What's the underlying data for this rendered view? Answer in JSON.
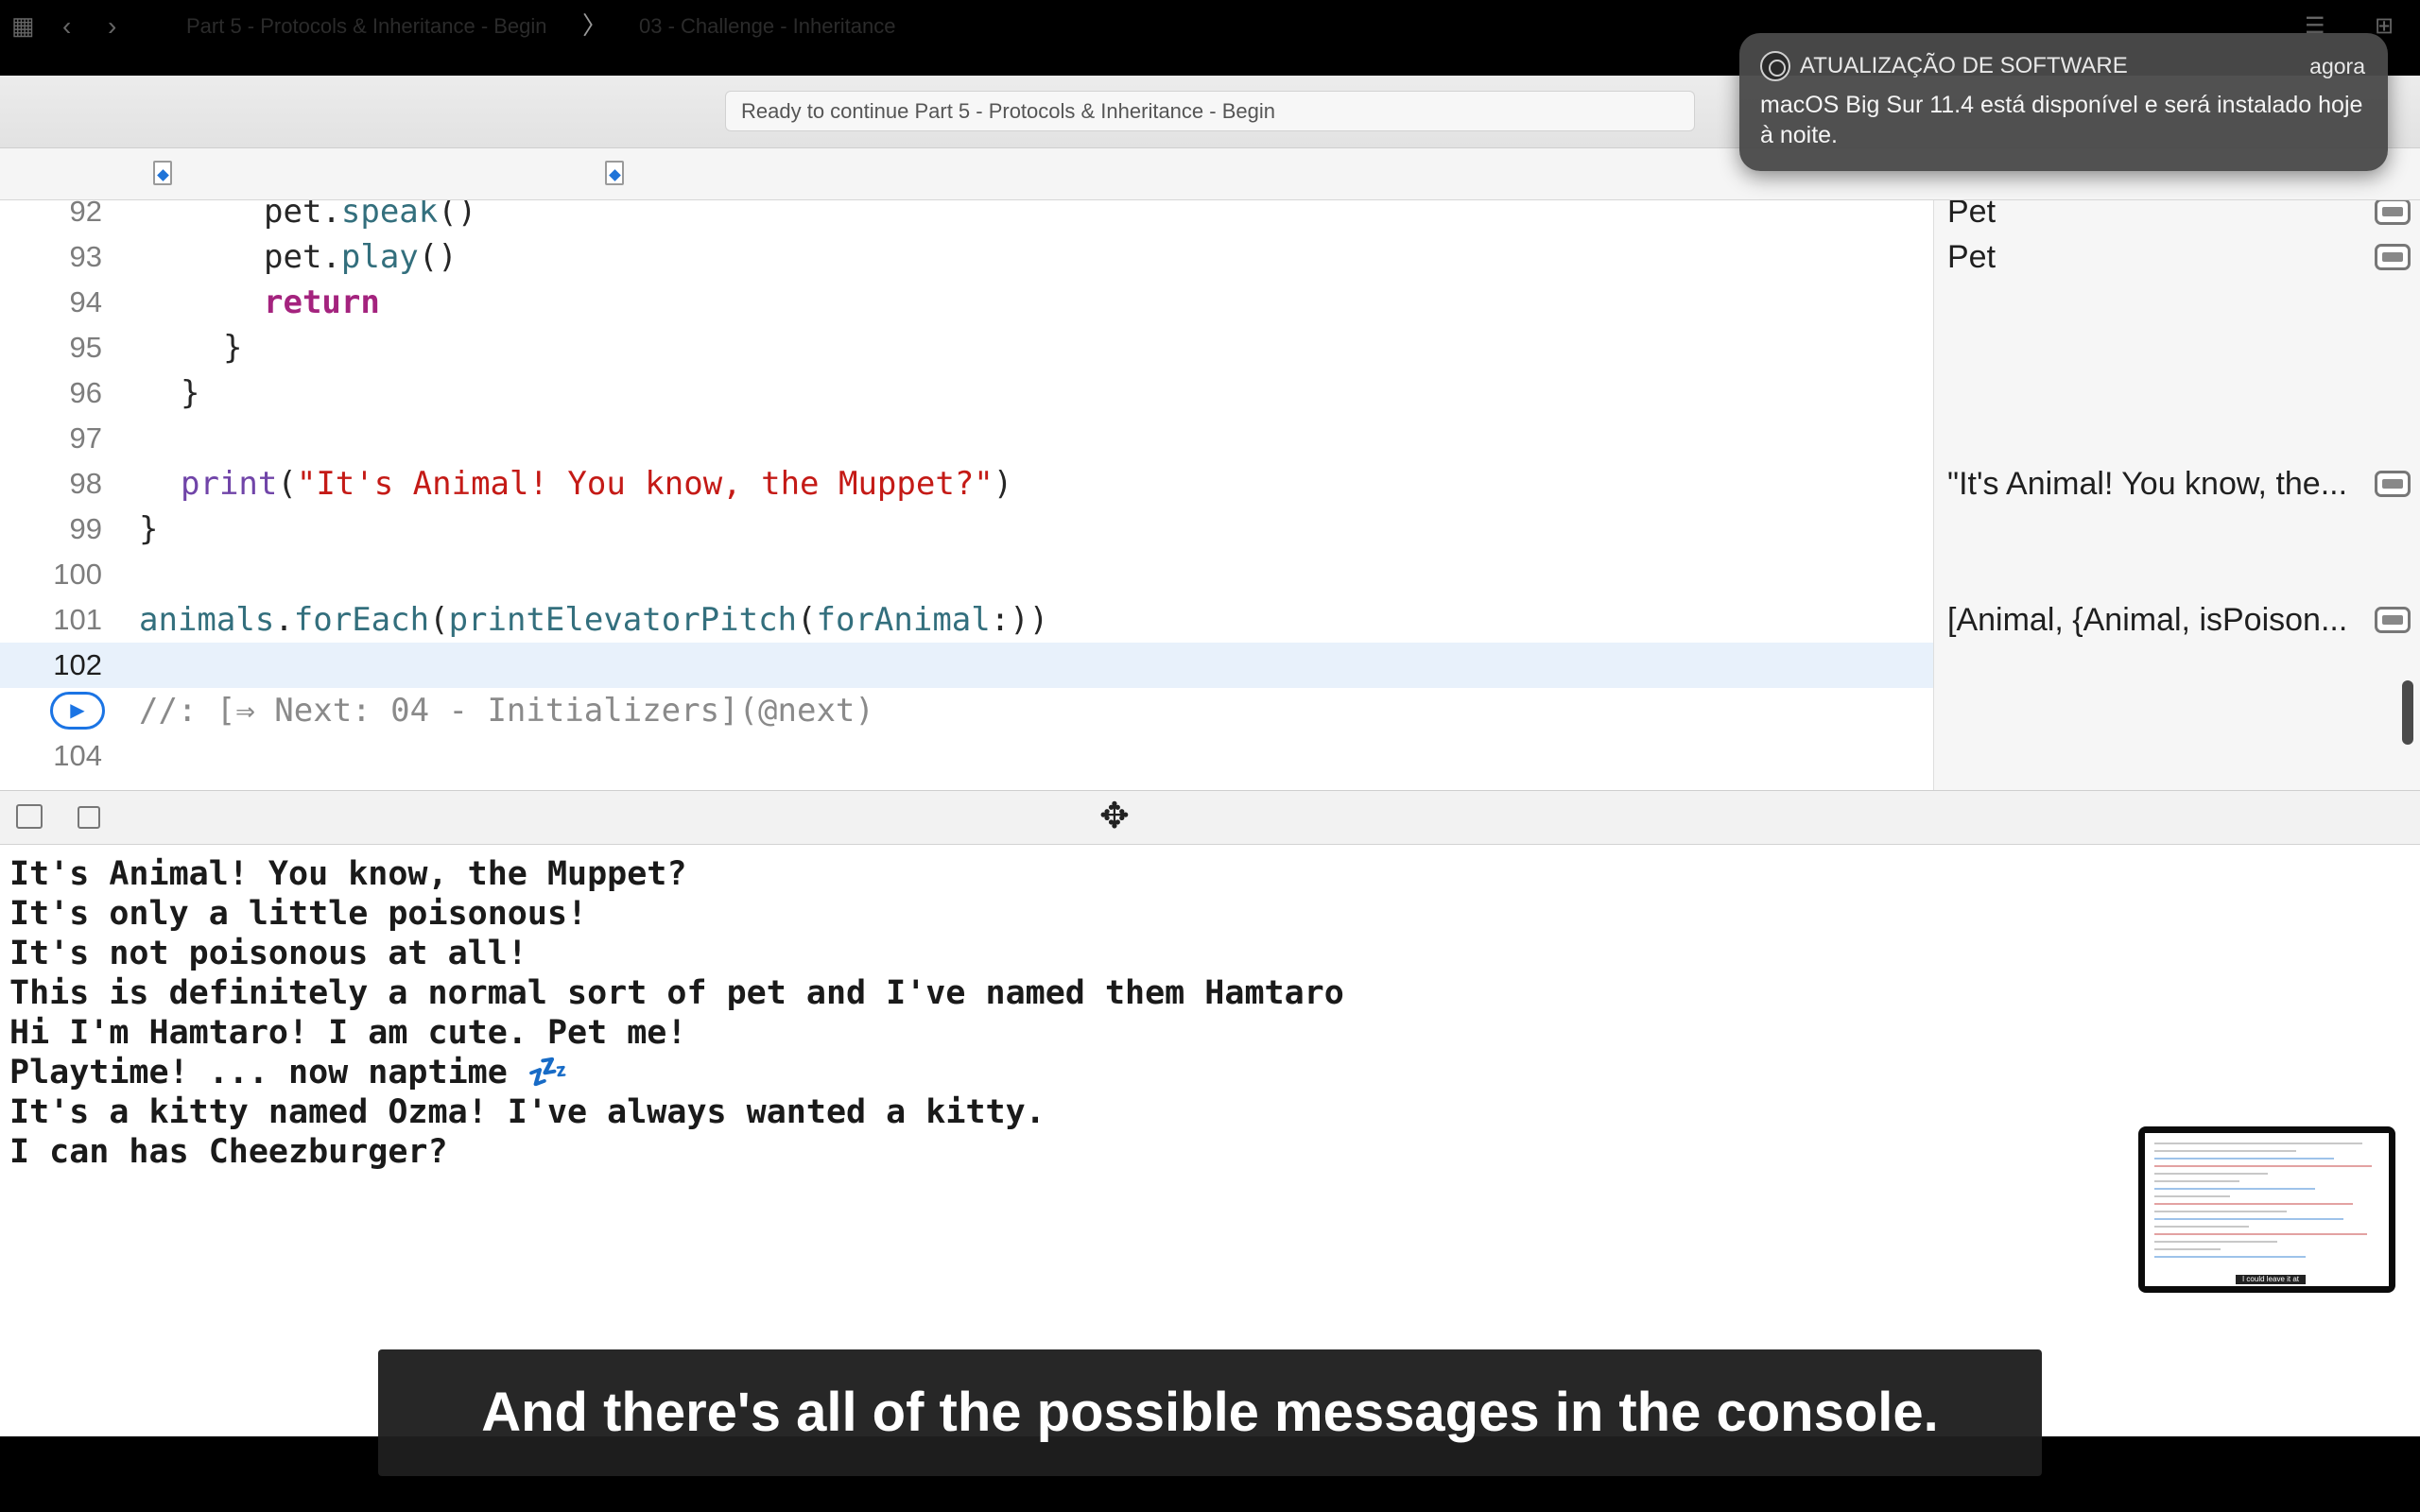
{
  "window": {
    "activity_text": "Ready to continue Part 5 - Protocols & Inheritance - Begin"
  },
  "pathbar": {
    "crumbs": [
      "Part 5 - Protocols & Inheritance - Begin",
      "03 - Challenge - Inheritance"
    ]
  },
  "editor": {
    "lines": [
      {
        "number": "92",
        "code": "pet.speak()"
      },
      {
        "number": "93",
        "code": "pet.play()"
      },
      {
        "number": "94",
        "code": "return"
      },
      {
        "number": "95",
        "code": "}"
      },
      {
        "number": "96",
        "code": "}"
      },
      {
        "number": "97",
        "code": ""
      },
      {
        "number": "98",
        "code": "print(\"It's Animal! You know, the Muppet?\")"
      },
      {
        "number": "99",
        "code": "}"
      },
      {
        "number": "100",
        "code": ""
      },
      {
        "number": "101",
        "code": "animals.forEach(printElevatorPitch(forAnimal:))"
      },
      {
        "number": "102",
        "code": ""
      },
      {
        "number": "",
        "code": "//: [⇒ Next: 04 - Initializers](@next)"
      },
      {
        "number": "104",
        "code": ""
      }
    ],
    "current_line": "102"
  },
  "results": {
    "items": [
      "Pet",
      "Pet",
      "\"It's Animal! You know, the...",
      "[Animal, {Animal, isPoison..."
    ]
  },
  "console": {
    "lines": [
      "It's Animal! You know, the Muppet?",
      "It's only a little poisonous!",
      "It's not poisonous at all!",
      "This is definitely a normal sort of pet and I've named them Hamtaro",
      "Hi I'm Hamtaro! I am cute. Pet me!",
      "Playtime! ... now naptime 💤",
      "It's a kitty named Ozma! I've always wanted a kitty.",
      "I can has Cheezburger?"
    ]
  },
  "notification": {
    "app": "ATUALIZAÇÃO DE SOFTWARE",
    "time": "agora",
    "body": "macOS Big Sur 11.4 está disponível e será instalado hoje à noite."
  },
  "subtitle": {
    "text": "And there's all of the possible messages in the console."
  },
  "thumbnail": {
    "caption": "I could leave it at that."
  }
}
